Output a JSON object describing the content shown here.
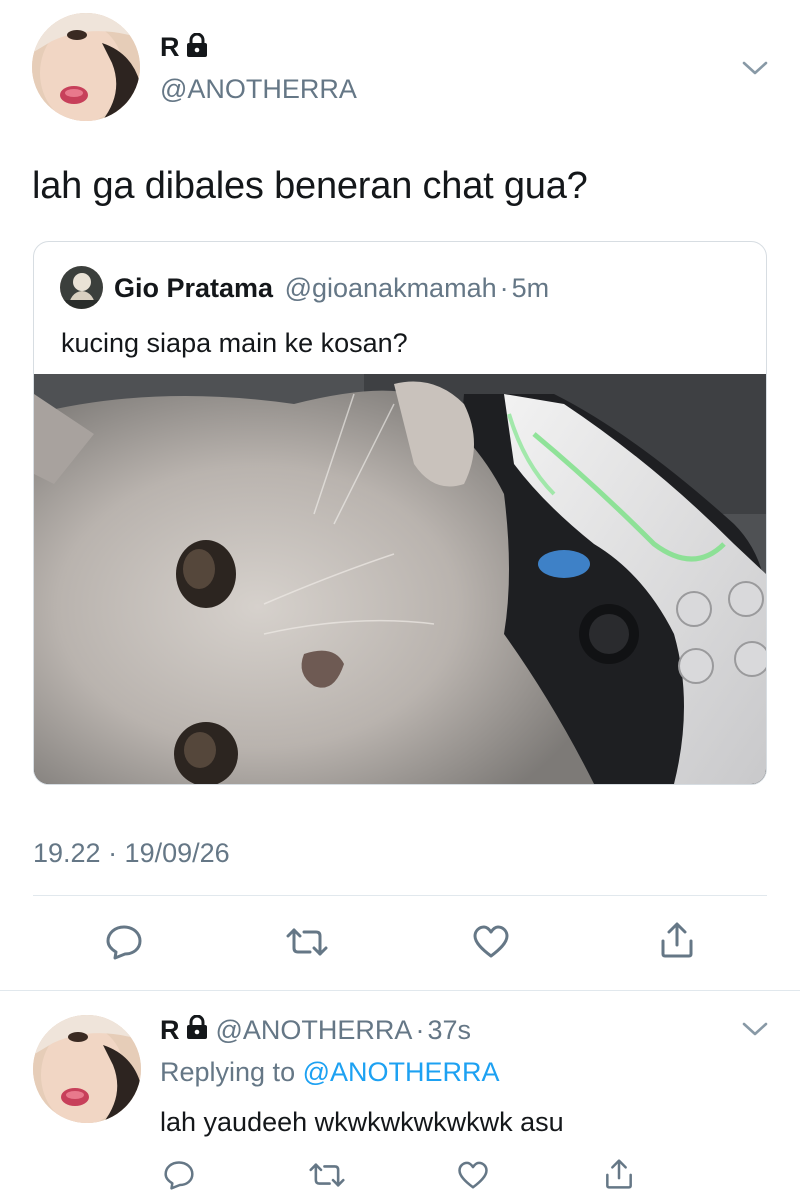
{
  "main_tweet": {
    "display_name": "R",
    "handle": "@ANOTHERRA",
    "text": "lah ga dibales beneran chat gua?",
    "timestamp": "19.22 · 19/09/26"
  },
  "quoted_tweet": {
    "display_name": "Gio Pratama",
    "handle": "@gioanakmamah",
    "separator": "·",
    "time": "5m",
    "text": "kucing siapa main ke kosan?"
  },
  "reply_tweet": {
    "display_name": "R",
    "handle": "@ANOTHERRA",
    "separator": "·",
    "time": "37s",
    "replying_prefix": "Replying to",
    "replying_to": "@ANOTHERRA",
    "text": "lah yaudeeh wkwkwkwkwkwk asu"
  },
  "icons": [
    "lock-icon",
    "chevron-down-icon",
    "reply-icon",
    "retweet-icon",
    "like-icon",
    "share-icon"
  ],
  "colors": {
    "link": "#1da1f2",
    "muted": "#657786",
    "text": "#14171a",
    "divider": "#e1e8ed"
  }
}
